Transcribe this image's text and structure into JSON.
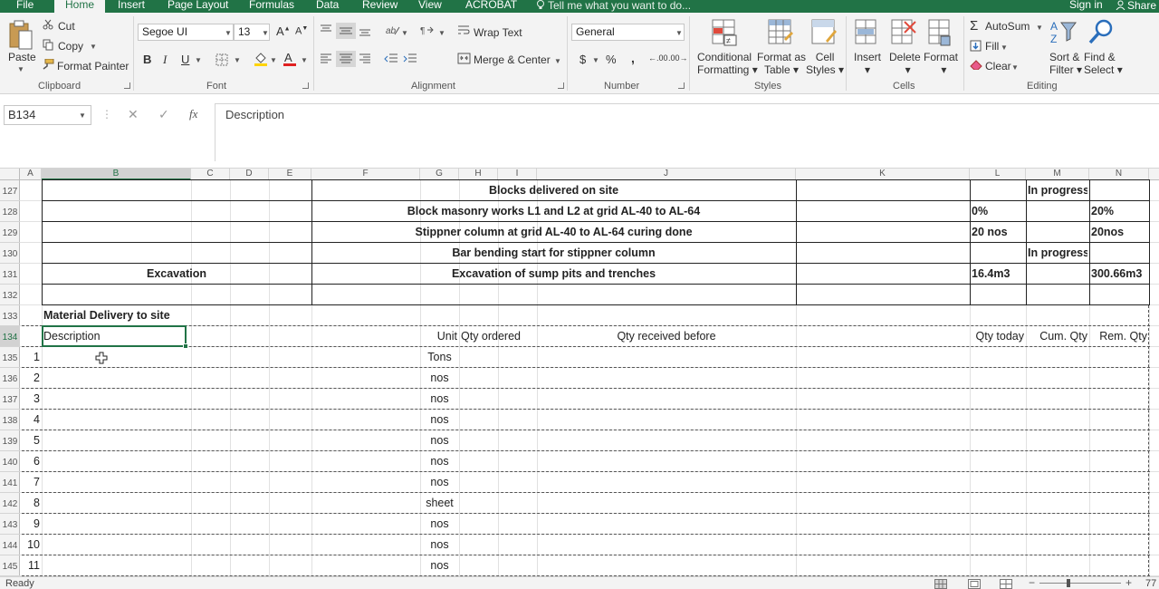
{
  "menubar": {
    "tabs": [
      "File",
      "Home",
      "Insert",
      "Page Layout",
      "Formulas",
      "Data",
      "Review",
      "View",
      "ACROBAT"
    ],
    "active_tab": "Home",
    "tell_me": "Tell me what you want to do...",
    "sign_in": "Sign in",
    "share": "Share"
  },
  "ribbon": {
    "clipboard": {
      "paste": "Paste",
      "cut": "Cut",
      "copy": "Copy",
      "format_painter": "Format Painter",
      "label": "Clipboard"
    },
    "font": {
      "name": "Segoe UI",
      "size": "13",
      "bold": "B",
      "italic": "I",
      "underline": "U",
      "label": "Font"
    },
    "alignment": {
      "wrap_text": "Wrap Text",
      "merge_center": "Merge & Center",
      "label": "Alignment"
    },
    "number": {
      "format": "General",
      "currency": "$",
      "percent": "%",
      "comma": ",",
      "inc_decimal": ".00",
      "dec_decimal": ".00",
      "label": "Number"
    },
    "styles": {
      "conditional": "Conditional",
      "conditional2": "Formatting",
      "format_as": "Format as",
      "format_as2": "Table",
      "cell_styles": "Cell",
      "cell_styles2": "Styles",
      "label": "Styles"
    },
    "cells": {
      "insert": "Insert",
      "delete": "Delete",
      "format": "Format",
      "label": "Cells"
    },
    "editing": {
      "autosum": "AutoSum",
      "fill": "Fill",
      "clear": "Clear",
      "sort": "Sort &",
      "sort2": "Filter",
      "find": "Find &",
      "find2": "Select",
      "label": "Editing"
    }
  },
  "formula_bar": {
    "name_box": "B134",
    "cancel": "✕",
    "enter": "✓",
    "fx": "fx",
    "content": "Description"
  },
  "columns": [
    "A",
    "B",
    "C",
    "D",
    "E",
    "F",
    "G",
    "H",
    "I",
    "J",
    "K",
    "L",
    "M",
    "N"
  ],
  "selected_column": "B",
  "rows": [
    "127",
    "128",
    "129",
    "130",
    "131",
    "132",
    "133",
    "134",
    "135",
    "136",
    "137",
    "138",
    "139",
    "140",
    "141",
    "142",
    "143",
    "144",
    "145"
  ],
  "selected_row": "134",
  "sheet": {
    "r127": {
      "task": "Blocks delivered on site",
      "m": "In progress"
    },
    "r128": {
      "task": "Block masonry works L1 and L2 at grid AL-40 to AL-64",
      "l": "0%",
      "n": "20%"
    },
    "r129": {
      "task": "Stippner column at grid AL-40 to AL-64 curing done",
      "l": "20 nos",
      "n": "20nos"
    },
    "r130": {
      "task": "Bar bending start for stippner column",
      "m": "In progress"
    },
    "r131": {
      "b": "Excavation",
      "task": "Excavation of sump pits and trenches",
      "l": "16.4m3",
      "n": "300.66m3"
    },
    "r133": {
      "b": "Material Delivery to site"
    },
    "r134": {
      "b": "Description",
      "g": "Unit",
      "h": "Qty ordered",
      "j": "Qty received before",
      "l": "Qty today",
      "m": "Cum. Qty",
      "n": "Rem. Qty"
    },
    "items": [
      {
        "no": "1",
        "unit": "Tons"
      },
      {
        "no": "2",
        "unit": "nos"
      },
      {
        "no": "3",
        "unit": "nos"
      },
      {
        "no": "4",
        "unit": "nos"
      },
      {
        "no": "5",
        "unit": "nos"
      },
      {
        "no": "6",
        "unit": "nos"
      },
      {
        "no": "7",
        "unit": "nos"
      },
      {
        "no": "8",
        "unit": "sheet"
      },
      {
        "no": "9",
        "unit": "nos"
      },
      {
        "no": "10",
        "unit": "nos"
      },
      {
        "no": "11",
        "unit": "nos"
      }
    ]
  },
  "status": {
    "text": "Ready",
    "zoom": "77"
  },
  "colors": {
    "brand": "#217346",
    "ribbon_bg": "#f3f3f3",
    "selection": "#217346"
  }
}
